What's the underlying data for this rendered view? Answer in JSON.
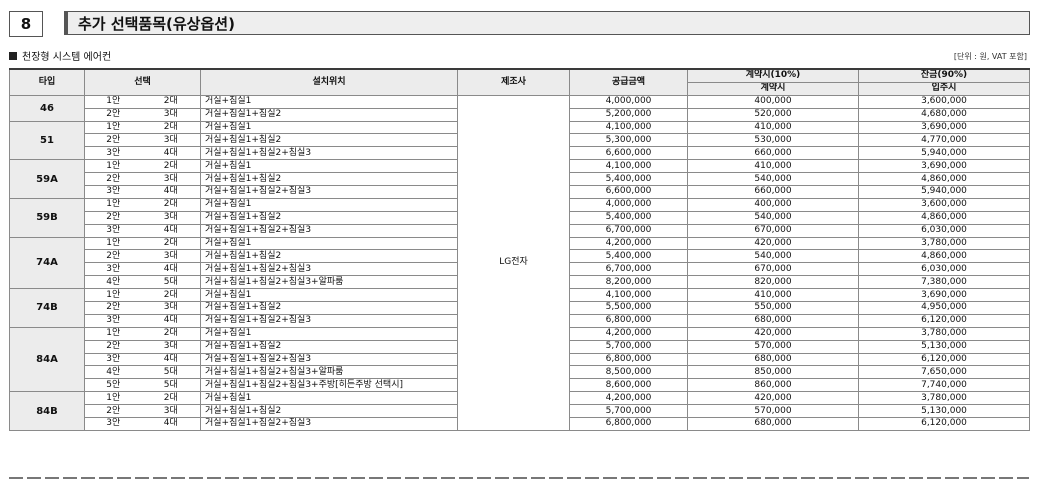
{
  "section": {
    "number": "8",
    "title": "추가 선택품목(유상옵션)"
  },
  "subtitle": "천장형 시스템 에어컨",
  "unit_note": "[단위 : 원, VAT 포함]",
  "headers": {
    "type": "타입",
    "selection": "선택",
    "location": "설치위치",
    "manufacturer": "제조사",
    "supply_price": "공급금액",
    "contract_group": "계약시(10%)",
    "contract": "계약시",
    "balance_group": "잔금(90%)",
    "movein": "입주시"
  },
  "manufacturer": "LG전자",
  "groups": [
    {
      "type": "46",
      "rows": [
        {
          "option": "1안",
          "count": "2대",
          "location": "거실+침실1",
          "supply": "4,000,000",
          "contract": "400,000",
          "balance": "3,600,000"
        },
        {
          "option": "2안",
          "count": "3대",
          "location": "거실+침실1+침실2",
          "supply": "5,200,000",
          "contract": "520,000",
          "balance": "4,680,000"
        }
      ]
    },
    {
      "type": "51",
      "rows": [
        {
          "option": "1안",
          "count": "2대",
          "location": "거실+침실1",
          "supply": "4,100,000",
          "contract": "410,000",
          "balance": "3,690,000"
        },
        {
          "option": "2안",
          "count": "3대",
          "location": "거실+침실1+침실2",
          "supply": "5,300,000",
          "contract": "530,000",
          "balance": "4,770,000"
        },
        {
          "option": "3안",
          "count": "4대",
          "location": "거실+침실1+침실2+침실3",
          "supply": "6,600,000",
          "contract": "660,000",
          "balance": "5,940,000"
        }
      ]
    },
    {
      "type": "59A",
      "rows": [
        {
          "option": "1안",
          "count": "2대",
          "location": "거실+침실1",
          "supply": "4,100,000",
          "contract": "410,000",
          "balance": "3,690,000"
        },
        {
          "option": "2안",
          "count": "3대",
          "location": "거실+침실1+침실2",
          "supply": "5,400,000",
          "contract": "540,000",
          "balance": "4,860,000"
        },
        {
          "option": "3안",
          "count": "4대",
          "location": "거실+침실1+침실2+침실3",
          "supply": "6,600,000",
          "contract": "660,000",
          "balance": "5,940,000"
        }
      ]
    },
    {
      "type": "59B",
      "rows": [
        {
          "option": "1안",
          "count": "2대",
          "location": "거실+침실1",
          "supply": "4,000,000",
          "contract": "400,000",
          "balance": "3,600,000"
        },
        {
          "option": "2안",
          "count": "3대",
          "location": "거실+침실1+침실2",
          "supply": "5,400,000",
          "contract": "540,000",
          "balance": "4,860,000"
        },
        {
          "option": "3안",
          "count": "4대",
          "location": "거실+침실1+침실2+침실3",
          "supply": "6,700,000",
          "contract": "670,000",
          "balance": "6,030,000"
        }
      ]
    },
    {
      "type": "74A",
      "rows": [
        {
          "option": "1안",
          "count": "2대",
          "location": "거실+침실1",
          "supply": "4,200,000",
          "contract": "420,000",
          "balance": "3,780,000"
        },
        {
          "option": "2안",
          "count": "3대",
          "location": "거실+침실1+침실2",
          "supply": "5,400,000",
          "contract": "540,000",
          "balance": "4,860,000"
        },
        {
          "option": "3안",
          "count": "4대",
          "location": "거실+침실1+침실2+침실3",
          "supply": "6,700,000",
          "contract": "670,000",
          "balance": "6,030,000"
        },
        {
          "option": "4안",
          "count": "5대",
          "location": "거실+침실1+침실2+침실3+알파룸",
          "supply": "8,200,000",
          "contract": "820,000",
          "balance": "7,380,000"
        }
      ]
    },
    {
      "type": "74B",
      "rows": [
        {
          "option": "1안",
          "count": "2대",
          "location": "거실+침실1",
          "supply": "4,100,000",
          "contract": "410,000",
          "balance": "3,690,000"
        },
        {
          "option": "2안",
          "count": "3대",
          "location": "거실+침실1+침실2",
          "supply": "5,500,000",
          "contract": "550,000",
          "balance": "4,950,000"
        },
        {
          "option": "3안",
          "count": "4대",
          "location": "거실+침실1+침실2+침실3",
          "supply": "6,800,000",
          "contract": "680,000",
          "balance": "6,120,000"
        }
      ]
    },
    {
      "type": "84A",
      "rows": [
        {
          "option": "1안",
          "count": "2대",
          "location": "거실+침실1",
          "supply": "4,200,000",
          "contract": "420,000",
          "balance": "3,780,000"
        },
        {
          "option": "2안",
          "count": "3대",
          "location": "거실+침실1+침실2",
          "supply": "5,700,000",
          "contract": "570,000",
          "balance": "5,130,000"
        },
        {
          "option": "3안",
          "count": "4대",
          "location": "거실+침실1+침실2+침실3",
          "supply": "6,800,000",
          "contract": "680,000",
          "balance": "6,120,000"
        },
        {
          "option": "4안",
          "count": "5대",
          "location": "거실+침실1+침실2+침실3+알파룸",
          "supply": "8,500,000",
          "contract": "850,000",
          "balance": "7,650,000"
        },
        {
          "option": "5안",
          "count": "5대",
          "location": "거실+침실1+침실2+침실3+주방[히든주방 선택시]",
          "supply": "8,600,000",
          "contract": "860,000",
          "balance": "7,740,000"
        }
      ]
    },
    {
      "type": "84B",
      "rows": [
        {
          "option": "1안",
          "count": "2대",
          "location": "거실+침실1",
          "supply": "4,200,000",
          "contract": "420,000",
          "balance": "3,780,000"
        },
        {
          "option": "2안",
          "count": "3대",
          "location": "거실+침실1+침실2",
          "supply": "5,700,000",
          "contract": "570,000",
          "balance": "5,130,000"
        },
        {
          "option": "3안",
          "count": "4대",
          "location": "거실+침실1+침실2+침실3",
          "supply": "6,800,000",
          "contract": "680,000",
          "balance": "6,120,000"
        }
      ]
    }
  ]
}
